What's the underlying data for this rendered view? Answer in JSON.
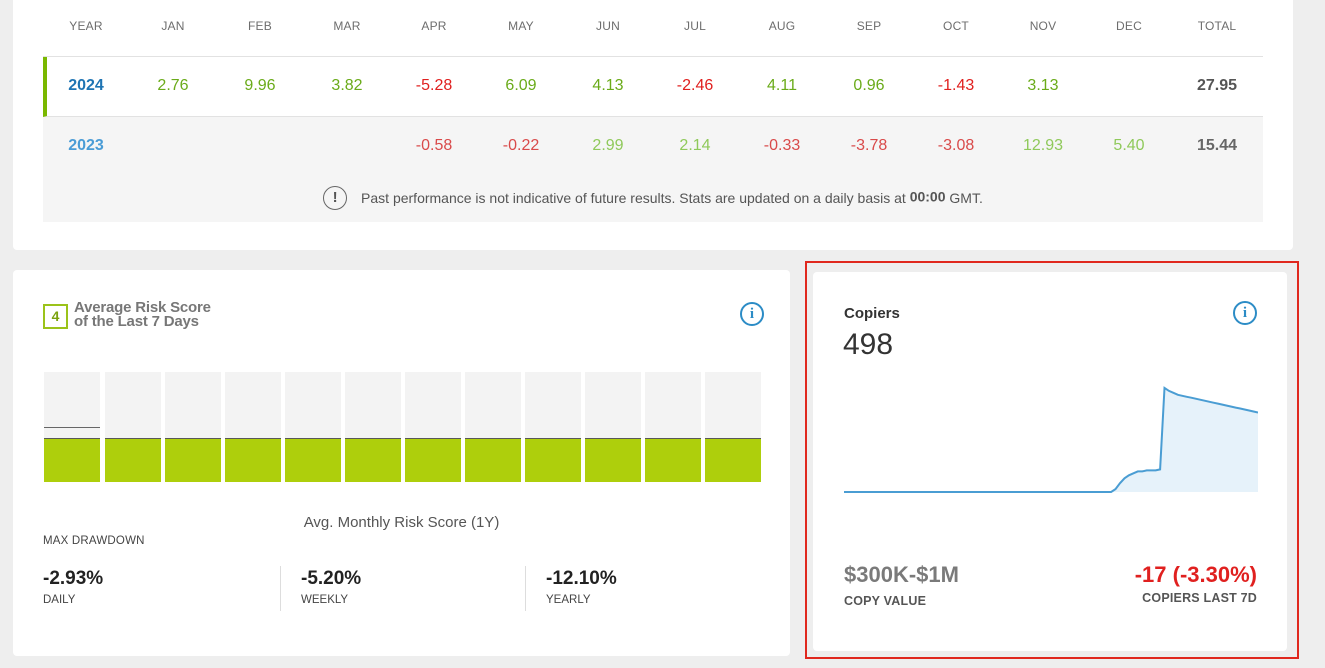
{
  "performance": {
    "headers": [
      "YEAR",
      "JAN",
      "FEB",
      "MAR",
      "APR",
      "MAY",
      "JUN",
      "JUL",
      "AUG",
      "SEP",
      "OCT",
      "NOV",
      "DEC",
      "TOTAL"
    ],
    "rows": [
      {
        "year": "2024",
        "months": [
          "2.76",
          "9.96",
          "3.82",
          "-5.28",
          "6.09",
          "4.13",
          "-2.46",
          "4.11",
          "0.96",
          "-1.43",
          "3.13",
          ""
        ],
        "total": "27.95"
      },
      {
        "year": "2023",
        "months": [
          "",
          "",
          "",
          "-0.58",
          "-0.22",
          "2.99",
          "2.14",
          "-0.33",
          "-3.78",
          "-3.08",
          "12.93",
          "5.40"
        ],
        "total": "15.44"
      }
    ],
    "disclaimer_icon": "!",
    "disclaimer_text": "Past performance is not indicative of future results. Stats are updated on a daily basis at",
    "disclaimer_time": "00:00",
    "disclaimer_tz": "GMT.",
    "colors": {
      "positive": "#6aab19",
      "negative": "#e0201f",
      "accent": "#7ab800"
    }
  },
  "risk": {
    "badge": "4",
    "title": "Average Risk Score of the Last 7 Days",
    "info_icon": "i",
    "bar_levels": [
      4,
      4,
      4,
      4,
      4,
      4,
      4,
      4,
      4,
      4,
      4,
      4
    ],
    "bar_max": 10,
    "first_bar_marker_level": 5,
    "bar_color": "#aecf0c",
    "caption": "Avg. Monthly Risk Score (1Y)",
    "max_drawdown_label": "MAX DRAWDOWN",
    "drawdowns": [
      {
        "value": "-2.93%",
        "label": "DAILY"
      },
      {
        "value": "-5.20%",
        "label": "WEEKLY"
      },
      {
        "value": "-12.10%",
        "label": "YEARLY"
      }
    ]
  },
  "copiers": {
    "title": "Copiers",
    "count": "498",
    "info_icon": "i",
    "chart_data": {
      "type": "area",
      "values": [
        0,
        0,
        0,
        0,
        0,
        0,
        0,
        0,
        0,
        0,
        0,
        0,
        0,
        0,
        0,
        0,
        0,
        0,
        0,
        0,
        0,
        0,
        0,
        0,
        0,
        0,
        0,
        0,
        0,
        0,
        0,
        0,
        0,
        0,
        0,
        0,
        0,
        0,
        0,
        0,
        0,
        0,
        0,
        0,
        0,
        0,
        0,
        0,
        0,
        0,
        0,
        0,
        0,
        0,
        0,
        0,
        0,
        0,
        0,
        0,
        0,
        3,
        9,
        14,
        17,
        19,
        21,
        21,
        22,
        22,
        22,
        23,
        106,
        103,
        101,
        99,
        98,
        97,
        96,
        95,
        94,
        93,
        92,
        91,
        90,
        89,
        88,
        87,
        86,
        85,
        84,
        83,
        82,
        81
      ],
      "ylim": [
        0,
        110
      ],
      "line_color": "#4a9dd3",
      "fill_color": "#e6f2fa"
    },
    "copy_value": "$300K-$1M",
    "copy_value_label": "COPY VALUE",
    "change": "-17 (-3.30%)",
    "change_label": "COPIERS LAST 7D"
  }
}
